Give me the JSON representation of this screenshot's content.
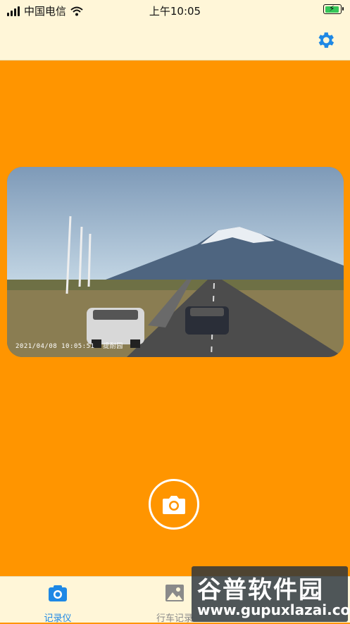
{
  "status": {
    "carrier": "中国电信",
    "time": "上午10:05",
    "battery_color": "#34C759"
  },
  "navbar": {
    "settings_icon": "gear-icon",
    "accent_color": "#1E88E5"
  },
  "camera_view": {
    "timestamp": "2021/04/08 10:05:51",
    "overlay_label": "提耐园"
  },
  "capture": {
    "icon": "camera-icon"
  },
  "tabs": [
    {
      "label": "记录仪",
      "icon": "camera-icon",
      "active": true
    },
    {
      "label": "行车记录",
      "icon": "image-icon",
      "active": false
    }
  ],
  "watermark": {
    "title": "谷普软件园",
    "url": "www.gupuxlazai.com"
  },
  "colors": {
    "background": "#FF9500",
    "bars": "#FFF6D8"
  }
}
